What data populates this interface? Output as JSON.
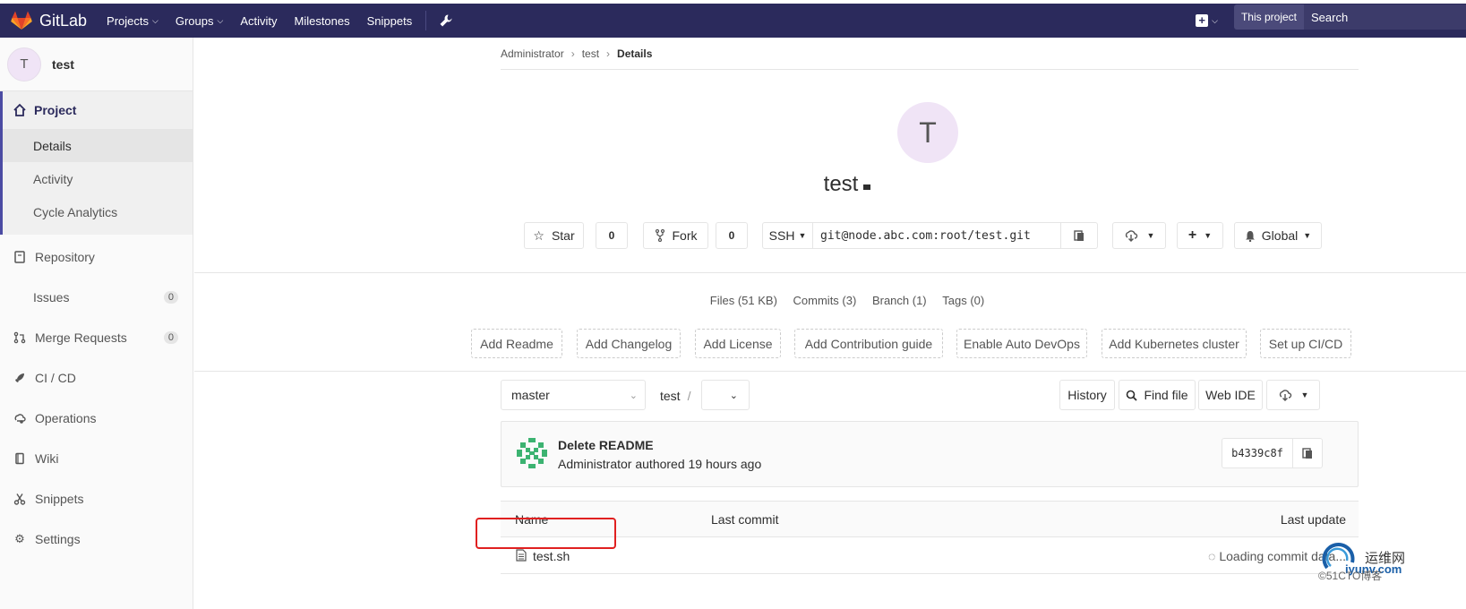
{
  "navbar": {
    "brand": "GitLab",
    "links": [
      {
        "label": "Projects",
        "dropdown": true
      },
      {
        "label": "Groups",
        "dropdown": true
      },
      {
        "label": "Activity"
      },
      {
        "label": "Milestones"
      },
      {
        "label": "Snippets"
      }
    ],
    "search_scope": "This project",
    "search_placeholder": "Search"
  },
  "sidebar": {
    "avatar_letter": "T",
    "title": "test",
    "project_label": "Project",
    "project_subitems": [
      "Details",
      "Activity",
      "Cycle Analytics"
    ],
    "items": [
      {
        "label": "Repository",
        "icon": "book-icon"
      },
      {
        "label": "Issues",
        "count": "0"
      },
      {
        "label": "Merge Requests",
        "icon": "merge-request-icon",
        "count": "0"
      },
      {
        "label": "CI / CD",
        "icon": "rocket-icon"
      },
      {
        "label": "Operations",
        "icon": "cloud-gear-icon"
      },
      {
        "label": "Wiki",
        "icon": "wiki-book-icon"
      },
      {
        "label": "Snippets",
        "icon": "scissors-icon"
      },
      {
        "label": "Settings",
        "icon": "gear-icon"
      }
    ]
  },
  "breadcrumb": [
    "Administrator",
    "test",
    "Details"
  ],
  "project": {
    "avatar_letter": "T",
    "name": "test",
    "star_label": "Star",
    "star_count": "0",
    "fork_label": "Fork",
    "fork_count": "0",
    "clone_protocol": "SSH",
    "clone_url": "git@node.abc.com:root/test.git",
    "notification_label": "Global"
  },
  "stats": [
    "Files (51 KB)",
    "Commits (3)",
    "Branch (1)",
    "Tags (0)"
  ],
  "quick_actions": [
    "Add Readme",
    "Add Changelog",
    "Add License",
    "Add Contribution guide",
    "Enable Auto DevOps",
    "Add Kubernetes cluster",
    "Set up CI/CD"
  ],
  "tree": {
    "branch": "master",
    "path": "test",
    "path_sep": "/",
    "history_label": "History",
    "find_file_label": "Find file",
    "web_ide_label": "Web IDE"
  },
  "last_commit": {
    "title": "Delete README",
    "byline": "Administrator authored 19 hours ago",
    "sha": "b4339c8f"
  },
  "table": {
    "headers": [
      "Name",
      "Last commit",
      "Last update"
    ],
    "rows": [
      {
        "name": "test.sh",
        "status": "Loading commit data..."
      }
    ]
  },
  "watermark": {
    "line1": "运维网",
    "line2": "©51CTO博客",
    "logo_text": "iyunv.com"
  },
  "colors": {
    "navbar_bg": "#2b2a5c",
    "accent": "#4b4ba3",
    "highlight_box": "#e02020"
  }
}
